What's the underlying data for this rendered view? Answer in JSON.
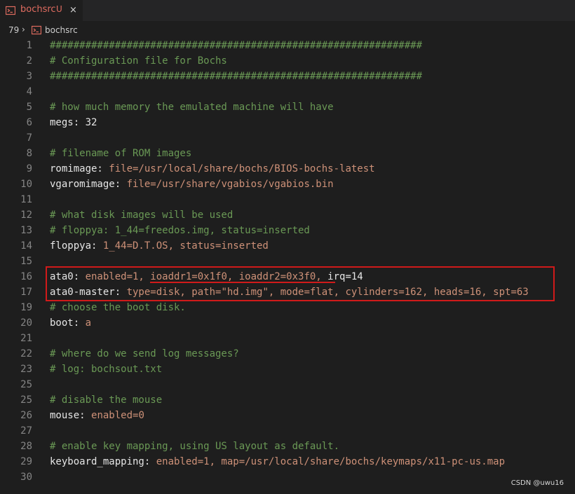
{
  "tab": {
    "title": "bochsrc",
    "status": "U",
    "close": "×",
    "icon": "terminal-file-icon"
  },
  "breadcrumb": {
    "line_count": "79",
    "separator": "›",
    "file": "bochsrc"
  },
  "colors": {
    "comment": "#6a9955",
    "key": "#e6e6e6",
    "value": "#ce9178",
    "annotation": "#d01a1a"
  },
  "lines": [
    {
      "n": "1",
      "parts": [
        {
          "t": "comment",
          "s": "###############################################################"
        }
      ]
    },
    {
      "n": "2",
      "parts": [
        {
          "t": "comment",
          "s": "# Configuration file for Bochs"
        }
      ]
    },
    {
      "n": "3",
      "parts": [
        {
          "t": "comment",
          "s": "###############################################################"
        }
      ]
    },
    {
      "n": "4",
      "parts": []
    },
    {
      "n": "5",
      "parts": [
        {
          "t": "comment",
          "s": "# how much memory the emulated machine will have"
        }
      ]
    },
    {
      "n": "6",
      "parts": [
        {
          "t": "key",
          "s": "megs: "
        },
        {
          "t": "key",
          "s": "32"
        }
      ]
    },
    {
      "n": "7",
      "parts": []
    },
    {
      "n": "8",
      "parts": [
        {
          "t": "comment",
          "s": "# filename of ROM images"
        }
      ]
    },
    {
      "n": "9",
      "parts": [
        {
          "t": "key",
          "s": "romimage: "
        },
        {
          "t": "val",
          "s": "file=/usr/local/share/bochs/BIOS-bochs-latest"
        }
      ]
    },
    {
      "n": "10",
      "parts": [
        {
          "t": "key",
          "s": "vgaromimage: "
        },
        {
          "t": "val",
          "s": "file=/usr/share/vgabios/vgabios.bin"
        }
      ]
    },
    {
      "n": "11",
      "parts": []
    },
    {
      "n": "12",
      "parts": [
        {
          "t": "comment",
          "s": "# what disk images will be used"
        }
      ]
    },
    {
      "n": "13",
      "parts": [
        {
          "t": "comment",
          "s": "# floppya: 1_44=freedos.img, status=inserted"
        }
      ]
    },
    {
      "n": "14",
      "parts": [
        {
          "t": "key",
          "s": "floppya: "
        },
        {
          "t": "val",
          "s": "1_44=D.T.OS, status=inserted"
        }
      ]
    },
    {
      "n": "15",
      "parts": []
    },
    {
      "n": "16",
      "parts": [
        {
          "t": "key",
          "s": "ata0: "
        },
        {
          "t": "val",
          "s": "enabled=1, ioaddr1=0x1f0, ioaddr2=0x3f0, "
        },
        {
          "t": "key",
          "s": "irq=14"
        }
      ]
    },
    {
      "n": "17",
      "parts": [
        {
          "t": "key",
          "s": "ata0-master: "
        },
        {
          "t": "val",
          "s": "type=disk, path=\"hd.img\", mode=flat, cylinders=162, heads=16, spt=63"
        }
      ]
    },
    {
      "n": "19",
      "parts": [
        {
          "t": "comment",
          "s": "# choose the boot disk."
        }
      ]
    },
    {
      "n": "20",
      "parts": [
        {
          "t": "key",
          "s": "boot: "
        },
        {
          "t": "val",
          "s": "a"
        }
      ]
    },
    {
      "n": "21",
      "parts": []
    },
    {
      "n": "22",
      "parts": [
        {
          "t": "comment",
          "s": "# where do we send log messages?"
        }
      ]
    },
    {
      "n": "23",
      "parts": [
        {
          "t": "comment",
          "s": "# log: bochsout.txt"
        }
      ]
    },
    {
      "n": "25",
      "parts": []
    },
    {
      "n": "25",
      "parts": [
        {
          "t": "comment",
          "s": "# disable the mouse"
        }
      ]
    },
    {
      "n": "26",
      "parts": [
        {
          "t": "key",
          "s": "mouse: "
        },
        {
          "t": "val",
          "s": "enabled=0"
        }
      ]
    },
    {
      "n": "27",
      "parts": []
    },
    {
      "n": "28",
      "parts": [
        {
          "t": "comment",
          "s": "# enable key mapping, using US layout as default."
        }
      ]
    },
    {
      "n": "29",
      "parts": [
        {
          "t": "key",
          "s": "keyboard_mapping: "
        },
        {
          "t": "val",
          "s": "enabled=1, map=/usr/local/share/bochs/keymaps/x11-pc-us.map"
        }
      ]
    },
    {
      "n": "30",
      "parts": []
    }
  ],
  "watermark": "CSDN @uwu16"
}
